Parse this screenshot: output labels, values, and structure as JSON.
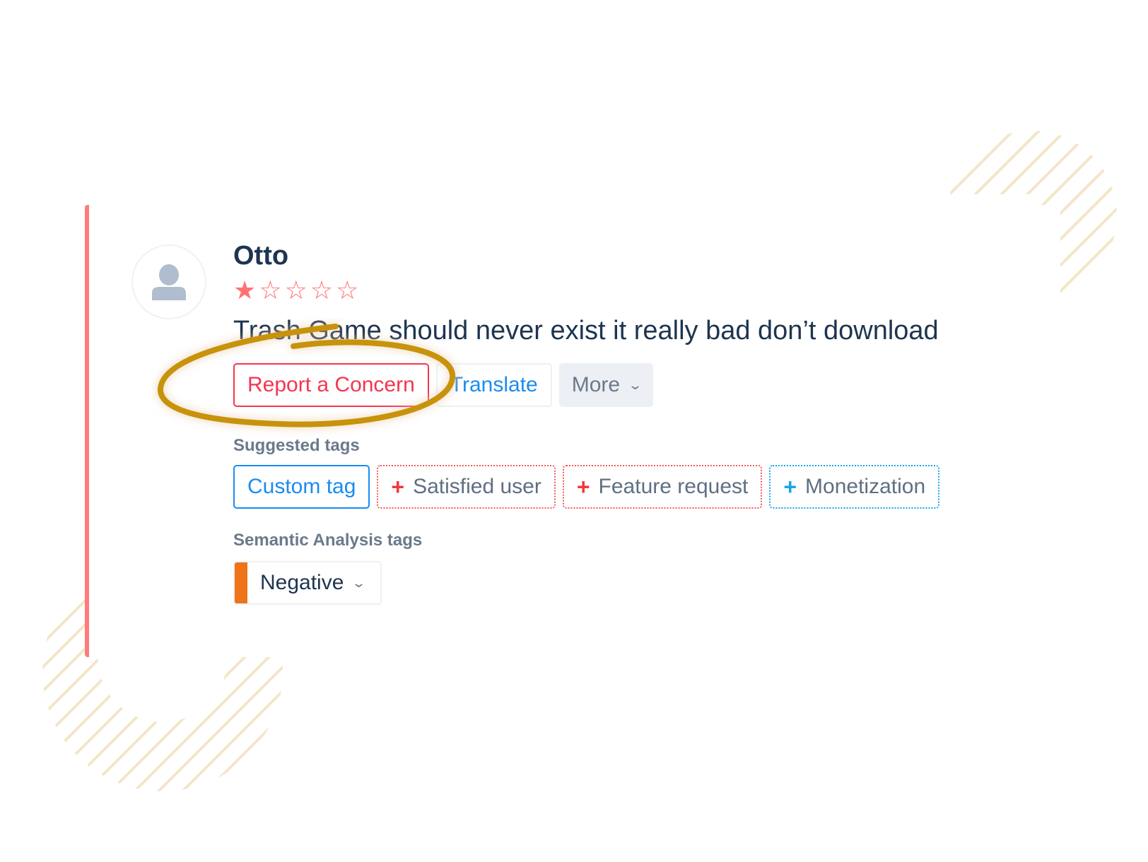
{
  "review": {
    "author": "Otto",
    "rating": 1,
    "max_rating": 5,
    "text": "Trash Game should never exist it really bad don’t download",
    "accent_color": "#ff7b7b"
  },
  "actions": {
    "report_label": "Report a Concern",
    "translate_label": "Translate",
    "more_label": "More"
  },
  "suggested_tags": {
    "label": "Suggested tags",
    "custom_label": "Custom tag",
    "items": [
      {
        "label": "Satisfied user",
        "color": "#f05a5a"
      },
      {
        "label": "Feature request",
        "color": "#f05a5a"
      },
      {
        "label": "Monetization",
        "color": "#19a4e6"
      }
    ]
  },
  "semantic_tags": {
    "label": "Semantic Analysis tags",
    "selected": "Negative",
    "color": "#ee7319"
  },
  "icons": {
    "star_filled": "★",
    "star_empty": "☆",
    "plus": "+",
    "chevron": "⌄"
  },
  "annotation": {
    "type": "hand-drawn-circle",
    "target": "Report a Concern",
    "color": "#c8920a"
  }
}
